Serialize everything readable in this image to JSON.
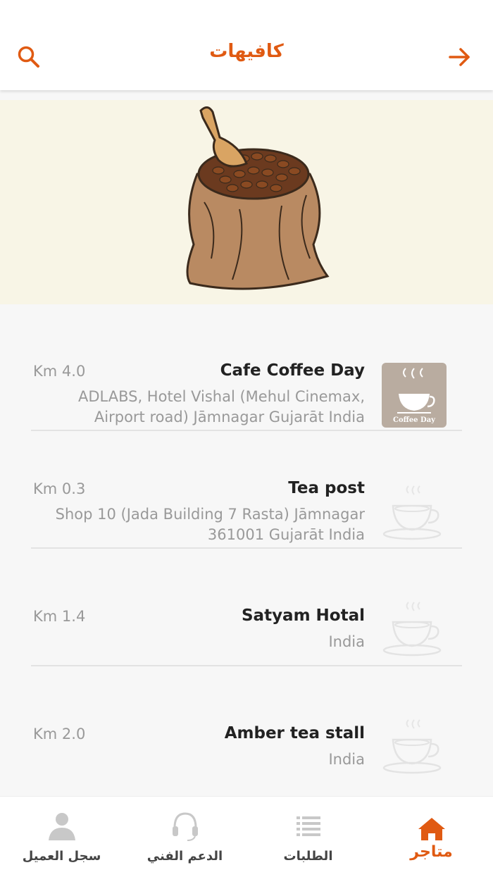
{
  "header": {
    "title": "كافيهات"
  },
  "stores": [
    {
      "name": "Cafe Coffee Day",
      "address": "ADLABS, Hotel Vishal (Mehul Cinemax, Airport road) Jāmnagar Gujarāt India",
      "distance": "Km 4.0",
      "logo_text": "Coffee Day"
    },
    {
      "name": "Tea post",
      "address": "Shop 10 (Jada Building 7 Rasta) Jāmnagar 361001 Gujarāt India",
      "distance": "Km 0.3"
    },
    {
      "name": "Satyam Hotal",
      "address": "India",
      "distance": "Km 1.4"
    },
    {
      "name": "Amber tea stall",
      "address": "India",
      "distance": "Km 2.0"
    }
  ],
  "tabs": {
    "profile": "سجل العميل",
    "support": "الدعم الفني",
    "orders": "الطلبات",
    "stores": "متاجر"
  },
  "colors": {
    "accent": "#e05a12",
    "banner_bg": "#f8f5e6"
  }
}
